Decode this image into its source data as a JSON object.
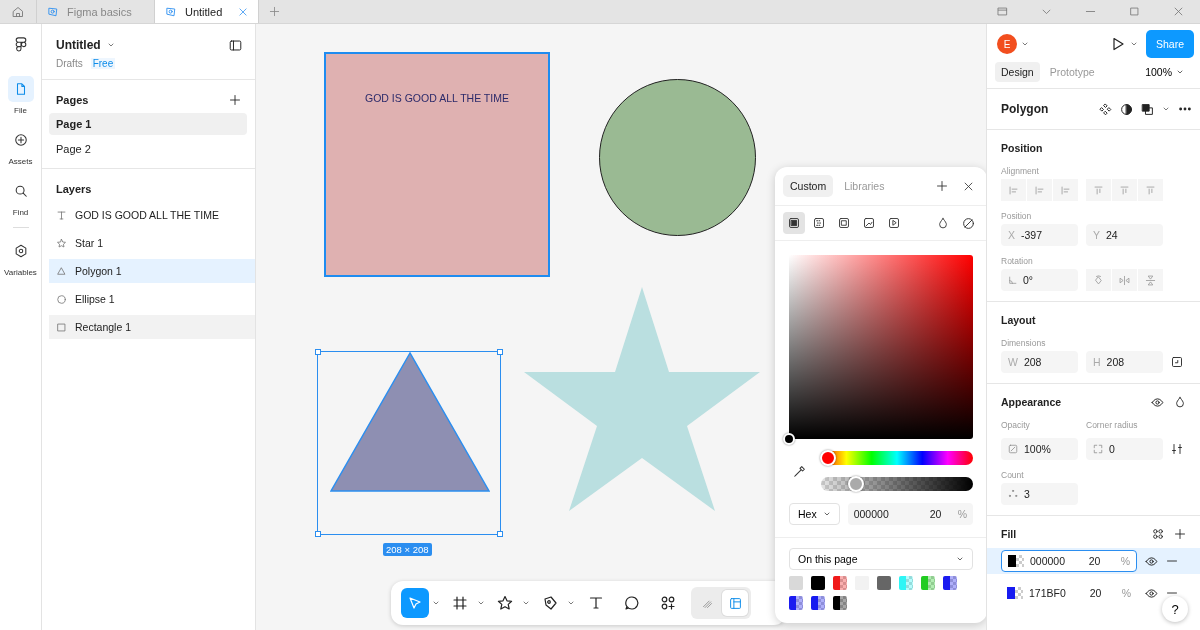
{
  "title_bar": {
    "tabs": [
      {
        "label": "Figma basics",
        "selected": false
      },
      {
        "label": "Untitled",
        "selected": true
      }
    ]
  },
  "rail": [
    {
      "label": "File",
      "kind": "file",
      "selected": true
    },
    {
      "label": "Assets",
      "kind": "assets",
      "selected": false
    },
    {
      "label": "Find",
      "kind": "find",
      "selected": false
    },
    {
      "label": "Variables",
      "kind": "variables",
      "selected": false
    }
  ],
  "file": {
    "name": "Untitled",
    "location": "Drafts",
    "plan": "Free"
  },
  "pages": {
    "title": "Pages",
    "items": [
      {
        "label": "Page 1",
        "selected": true
      },
      {
        "label": "Page 2",
        "selected": false
      }
    ]
  },
  "layers": {
    "title": "Layers",
    "items": [
      {
        "label": "GOD IS GOOD ALL THE TIME",
        "kind": "text",
        "selected": false,
        "hovered": false
      },
      {
        "label": "Star 1",
        "kind": "star",
        "selected": false,
        "hovered": false
      },
      {
        "label": "Polygon 1",
        "kind": "polygon",
        "selected": true,
        "hovered": false
      },
      {
        "label": "Ellipse 1",
        "kind": "ellipse",
        "selected": false,
        "hovered": false
      },
      {
        "label": "Rectangle 1",
        "kind": "rectangle",
        "selected": false,
        "hovered": true
      }
    ]
  },
  "canvas": {
    "objects": [
      {
        "kind": "rectangle",
        "text": "GOD IS GOOD ALL THE TIME",
        "color": "#dfb1b1",
        "selected": false,
        "hovered": true
      },
      {
        "kind": "ellipse",
        "color": "#9aba93",
        "selected": false,
        "hovered": false
      },
      {
        "kind": "polygon",
        "color": "#8e8fb2",
        "selected": true,
        "hovered": false,
        "size": "208 × 208"
      },
      {
        "kind": "star",
        "color": "#badfe0",
        "selected": false,
        "hovered": false
      }
    ]
  },
  "color_picker": {
    "tabs": [
      {
        "label": "Custom",
        "selected": true
      },
      {
        "label": "Libraries",
        "selected": false
      }
    ],
    "fill_types": [
      {
        "kind": "solid",
        "selected": true
      },
      {
        "kind": "gradient",
        "selected": false
      },
      {
        "kind": "pattern",
        "selected": false
      },
      {
        "kind": "image",
        "selected": false
      },
      {
        "kind": "video",
        "selected": false
      }
    ],
    "hue": {
      "level": 0
    },
    "alpha": {
      "level": 0.2
    },
    "format": "Hex",
    "hex": "000000",
    "opacity": "20",
    "unit": "%",
    "library": "On this page",
    "swatches": [
      {
        "color": "#d9d9d9",
        "translucent": false
      },
      {
        "color": "#000000",
        "translucent": false
      },
      {
        "color": "#f01a1a",
        "translucent": true
      },
      {
        "color": "#f2f2f2",
        "translucent": false
      },
      {
        "color": "#666666",
        "translucent": false
      },
      {
        "color": "#2ef5f5",
        "translucent": true
      },
      {
        "color": "#22cc22",
        "translucent": true
      },
      {
        "color": "#1b1bf0",
        "translucent": true
      },
      {
        "color": "#1b1bf0",
        "translucent": true
      },
      {
        "color": "#171bf0",
        "translucent": true
      },
      {
        "color": "#000000",
        "translucent": true
      }
    ]
  },
  "toolbar": {
    "tools": [
      {
        "kind": "move",
        "selected": true,
        "menu": true
      },
      {
        "kind": "frame",
        "selected": false,
        "menu": true
      },
      {
        "kind": "shape",
        "selected": false,
        "menu": true
      },
      {
        "kind": "pen",
        "selected": false,
        "menu": true
      },
      {
        "kind": "text",
        "selected": false,
        "menu": false
      },
      {
        "kind": "comment",
        "selected": false,
        "menu": false
      },
      {
        "kind": "actions",
        "selected": false,
        "menu": false
      }
    ],
    "modes": [
      {
        "kind": "draw",
        "selected": false
      },
      {
        "kind": "design",
        "selected": true
      }
    ]
  },
  "right": {
    "avatar": "E",
    "share": "Share",
    "tabs": [
      {
        "label": "Design",
        "selected": true
      },
      {
        "label": "Prototype",
        "selected": false
      }
    ],
    "zoom": "100%",
    "selection": "Polygon",
    "position": {
      "title": "Position",
      "alignment_label": "Alignment",
      "position_label": "Position",
      "x": {
        "prefix": "X",
        "value": "-397"
      },
      "y": {
        "prefix": "Y",
        "value": "24"
      },
      "rotation_label": "Rotation",
      "rotation": "0°"
    },
    "layout": {
      "title": "Layout",
      "dimensions_label": "Dimensions",
      "w": {
        "prefix": "W",
        "value": "208"
      },
      "h": {
        "prefix": "H",
        "value": "208"
      }
    },
    "appearance": {
      "title": "Appearance",
      "opacity_label": "Opacity",
      "opacity": "100%",
      "corner_label": "Corner radius",
      "corner": "0",
      "count_label": "Count",
      "count": "3"
    },
    "fill": {
      "title": "Fill",
      "items": [
        {
          "hex": "000000",
          "opacity": "20",
          "unit": "%",
          "color": "#000000",
          "selected": true
        },
        {
          "hex": "171BF0",
          "opacity": "20",
          "unit": "%",
          "color": "#171bf0",
          "selected": false
        }
      ]
    }
  },
  "help": "?"
}
